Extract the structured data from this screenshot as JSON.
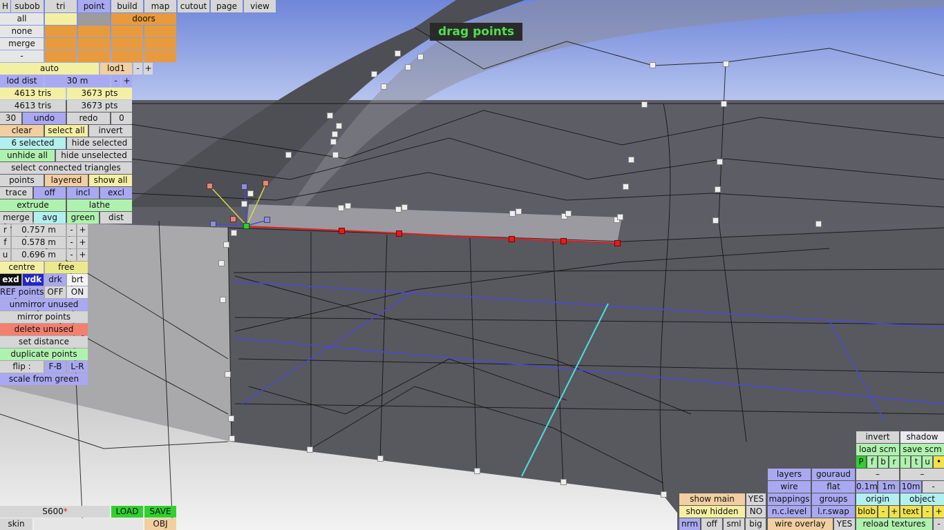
{
  "viewport_title": "drag points",
  "colors": {
    "background": "#5e5e66",
    "selected_edge": "#e21d1d",
    "green_point": "#27d627",
    "wire_blue": "#4a4ad6",
    "wire_cyan": "#4ce0e0"
  },
  "top_tabs": {
    "h": "H",
    "subob": "subob",
    "tri": "tri",
    "point": "point",
    "build": "build",
    "map": "map",
    "cutout": "cutout",
    "page": "page",
    "view": "view"
  },
  "select_panel": {
    "all": "all",
    "none": "none",
    "merge": "merge",
    "minus": "-",
    "doors": "doors"
  },
  "lod": {
    "auto": "auto",
    "lod1": "lod1",
    "minus": "-",
    "plus": "+",
    "lod_dist": "lod dist",
    "dist_value": "30 m"
  },
  "stats": {
    "tris1": "4613 tris",
    "pts1": "3673 pts",
    "tris2": "4613 tris",
    "pts2": "3673 pts"
  },
  "history": {
    "count": "30",
    "undo": "undo",
    "redo": "redo",
    "redo_count": "0"
  },
  "selection": {
    "clear": "clear",
    "select_all": "select all",
    "invert": "invert",
    "selected": "6 selected",
    "hide_selected": "hide selected",
    "unhide_all": "unhide all",
    "hide_unselected": "hide unselected",
    "select_connected": "select connected triangles"
  },
  "modes": {
    "points": "points",
    "layered": "layered",
    "show_all": "show all",
    "trace": "trace",
    "off": "off",
    "incl": "incl",
    "excl": "excl",
    "extrude": "extrude",
    "lathe": "lathe",
    "merge": "merge",
    "avg": "avg",
    "green": "green",
    "dist": "dist"
  },
  "coords": [
    {
      "axis": "r",
      "value": "0.757 m"
    },
    {
      "axis": "f",
      "value": "0.578 m"
    },
    {
      "axis": "u",
      "value": "0.696 m"
    }
  ],
  "pivot": {
    "centre": "centre",
    "free": "free"
  },
  "display": {
    "exd": "exd",
    "vdk": "vdk",
    "drk": "drk",
    "brt": "brt"
  },
  "ref_points": {
    "label": "REF points",
    "off": "OFF",
    "on": "ON"
  },
  "actions": {
    "unmirror_unused": "unmirror unused",
    "mirror_points": "mirror points",
    "delete_unused": "delete unused",
    "set_distance": "set distance",
    "duplicate_points": "duplicate points",
    "flip": "flip :",
    "fb": "F-B",
    "lr": "L-R",
    "scale_from_green": "scale from green"
  },
  "file": {
    "name": "S600",
    "modified": "*",
    "load": "LOAD",
    "save": "SAVE",
    "skin": "skin",
    "obj": "OBJ"
  },
  "bottom": {
    "show_main": "show main",
    "yes": "YES",
    "show_hidden": "show hidden",
    "no": "NO",
    "nrm": "nrm",
    "off": "off",
    "sml": "sml",
    "big": "big",
    "layers": "layers",
    "gouraud": "gouraud",
    "wire": "wire",
    "flat": "flat",
    "mappings": "mappings",
    "groups": "groups",
    "nc_level": "n.c.level",
    "lr_swap": "l.r.swap",
    "wire_overlay": "wire overlay",
    "wire_yes": "YES",
    "invert": "invert",
    "shadow": "shadow",
    "load_scm": "load scm",
    "save_scm": "save scm",
    "views": [
      "P",
      "f",
      "b",
      "r",
      "l",
      "t",
      "u",
      "•"
    ],
    "dash": "–",
    "g01": "0.1m",
    "g1": "1m",
    "g10": "10m",
    "minus": "-",
    "origin": "origin",
    "object": "object",
    "blob": "blob",
    "text": "text",
    "plus": "+",
    "reload_textures": "reload textures"
  }
}
